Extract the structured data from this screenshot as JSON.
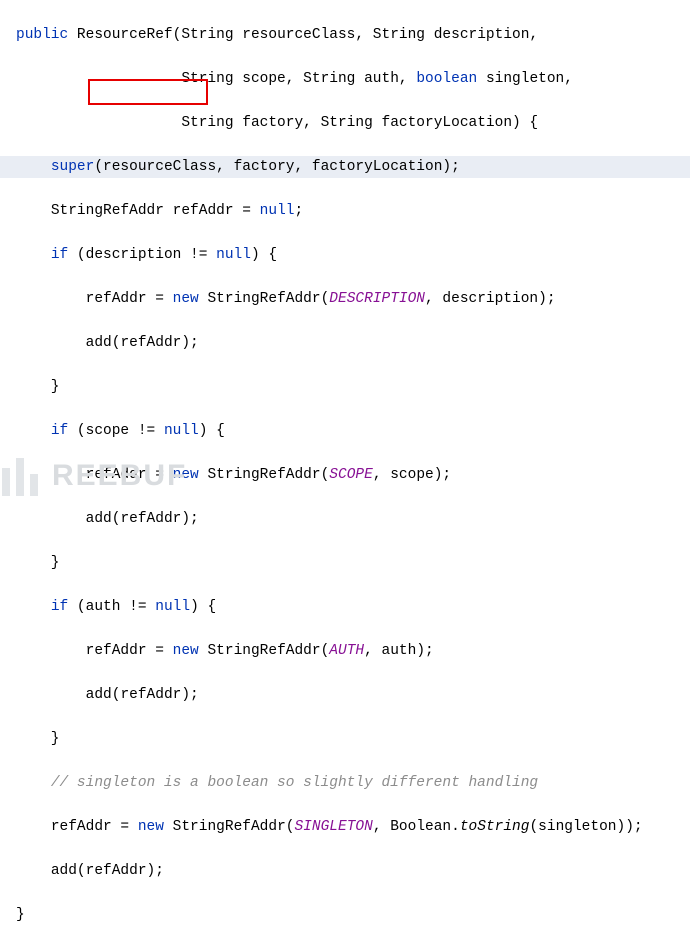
{
  "code": {
    "kw_public": "public",
    "ctor": "ResourceRef",
    "p_resourceClass": "resourceClass",
    "p_description": "description",
    "p_scope": "scope",
    "p_auth": "auth",
    "kw_boolean": "boolean",
    "p_singleton": "singleton",
    "p_factory": "factory",
    "p_factoryLocation": "factoryLocation",
    "kw_super": "super",
    "type_StringRefAddr": "StringRefAddr",
    "var_refAddr": "refAddr",
    "kw_null": "null",
    "kw_if": "if",
    "kw_new": "new",
    "const_DESCRIPTION": "DESCRIPTION",
    "const_SCOPE": "SCOPE",
    "const_AUTH": "AUTH",
    "const_SINGLETON": "SINGLETON",
    "fn_add": "add",
    "comment_singleton": "// singleton is a boolean so slightly different handling",
    "type_Boolean": "Boolean",
    "fn_toString": "toString",
    "type_String": "String"
  },
  "watermark": {
    "text": "REEBUF"
  }
}
